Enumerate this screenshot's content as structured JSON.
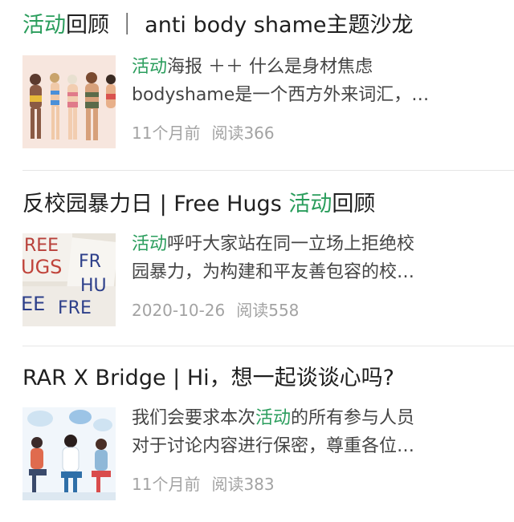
{
  "articles": [
    {
      "title_hl": "活动",
      "title_rest": "回顾 ｜ anti body shame主题沙龙",
      "desc_line1_hl": "活动",
      "desc_line1_rest": "海报 ＋＋ 什么是身材焦虑",
      "desc_line2": "bodyshame是一个西方外来词汇，…",
      "date": "11个月前",
      "reads": "阅读366",
      "thumb_icon": "body-positivity-illustration"
    },
    {
      "title_pre": "反校园暴力日 | Free Hugs ",
      "title_hl": "活动",
      "title_rest": "回顾",
      "desc_line1_hl": "活动",
      "desc_line1_rest": "呼吁大家站在同一立场上拒绝校",
      "desc_line2": "园暴力，为构建和平友善包容的校…",
      "date": "2020-10-26",
      "reads": "阅读558",
      "thumb_text_a": "REE",
      "thumb_text_b": "UGS",
      "thumb_text_c": "FR",
      "thumb_text_d": "HU",
      "thumb_text_e": "EE",
      "thumb_text_f": "FRE"
    },
    {
      "title": "RAR X Bridge | Hi，想一起谈谈心吗?",
      "desc_line1_pre": "我们会要求本次",
      "desc_line1_hl": "活动",
      "desc_line1_rest": "的所有参与人员",
      "desc_line2": "对于讨论内容进行保密，尊重各位…",
      "date": "11个月前",
      "reads": "阅读383",
      "thumb_icon": "group-conversation-illustration"
    }
  ],
  "colors": {
    "highlight": "#2a9d5c",
    "meta": "#a3a3a3"
  }
}
